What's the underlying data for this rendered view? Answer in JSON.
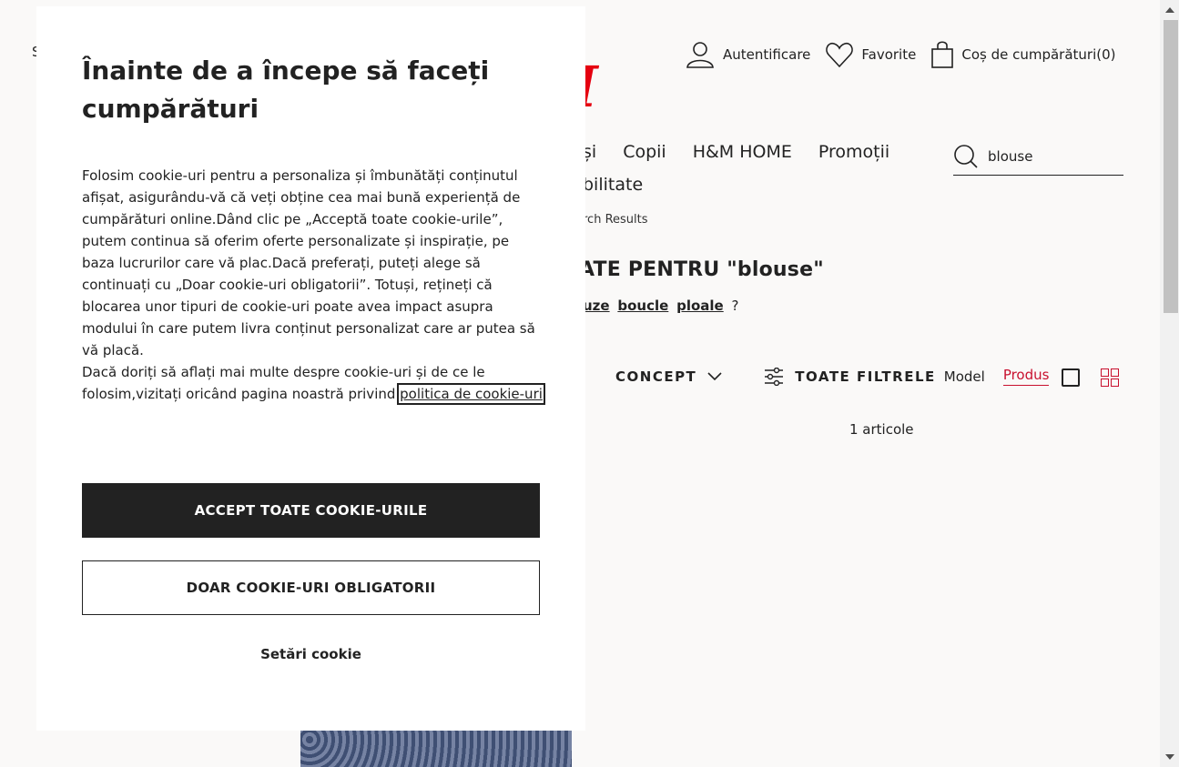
{
  "header": {
    "left_char": "S",
    "login_label": "Autentificare",
    "favorites_label": "Favorite",
    "cart_label": "Coș de cumpărături(0)",
    "logo_text": "H&M"
  },
  "nav": {
    "items": [
      "și",
      "Copii",
      "H&M HOME",
      "Promoții"
    ],
    "second_line": "bilitate"
  },
  "search": {
    "value": "blouse"
  },
  "breadcrumb": "rch Results",
  "results": {
    "title": "ATE PENTRU \"blouse\"",
    "suggestions": [
      "uze",
      "boucle",
      "ploale"
    ],
    "suggest_suffix": "?",
    "count_label": "1 articole"
  },
  "filters": {
    "concept_label": "CONCEPT",
    "all_filters_label": "TOATE FILTRELE",
    "model_label": "Model",
    "product_label": "Produs"
  },
  "cookie_modal": {
    "title": "Înainte de a începe să faceți cumpărături",
    "paragraph1": "Folosim cookie-uri pentru a personaliza și îmbunătăți conținutul afișat, asigurându-vă că veți obține cea mai bună experiență de cumpărături online.Dând clic pe „Acceptă toate cookie-urile”, putem continua să oferim oferte personalizate și inspirație, pe baza lucrurilor care vă plac.Dacă preferați, puteți alege să continuați cu „Doar cookie-uri obligatorii”. Totuși, rețineți că blocarea unor tipuri de cookie-uri poate avea impact asupra modului în care putem livra conținut personalizat care ar putea să vă placă.",
    "paragraph2_prefix": "Dacă doriți să aflați mai multe despre cookie-uri și de ce le folosim,vizitați oricând pagina noastră privind ",
    "policy_link": "politica de cookie-uri",
    "accept_all_label": "ACCEPT TOATE COOKIE-URILE",
    "required_only_label": "DOAR COOKIE-URI OBLIGATORII",
    "settings_label": "Setări cookie"
  },
  "colors": {
    "brand_red": "#c8102e",
    "dark": "#222222",
    "page_bg": "#faf9f8"
  }
}
